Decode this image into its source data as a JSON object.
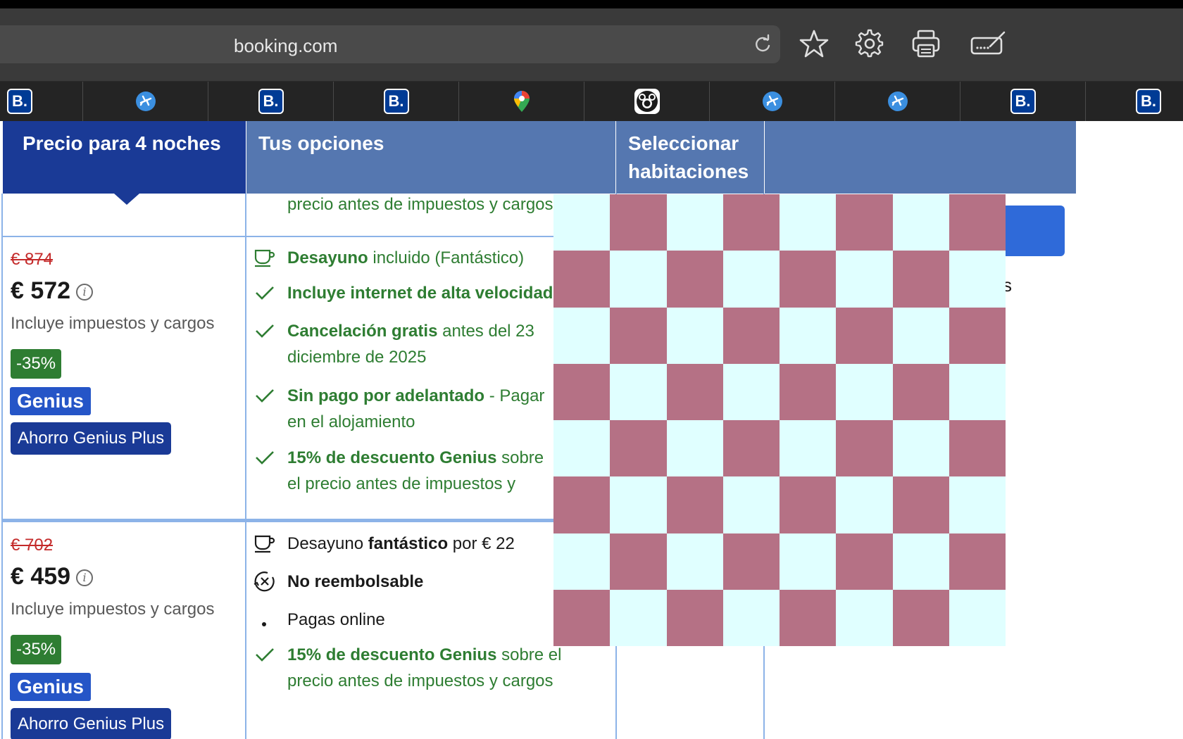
{
  "browser": {
    "url": "booking.com",
    "toolbar_icons": [
      "reload-icon",
      "star-icon",
      "gear-icon",
      "printer-icon",
      "signature-icon"
    ],
    "tabs": [
      {
        "icon": "booking-icon",
        "label": "B."
      },
      {
        "icon": "plane-icon"
      },
      {
        "icon": "booking-icon",
        "label": "B."
      },
      {
        "icon": "booking-icon",
        "label": "B."
      },
      {
        "icon": "maps-pin-icon"
      },
      {
        "icon": "mickey-icon"
      },
      {
        "icon": "plane-icon"
      },
      {
        "icon": "plane-icon"
      },
      {
        "icon": "booking-icon",
        "label": "B."
      },
      {
        "icon": "booking-icon",
        "label": "B."
      }
    ]
  },
  "table": {
    "headers": {
      "price": "Precio para 4 noches",
      "options": "Tus opciones",
      "select": "Seleccionar habitaciones"
    },
    "top_partial": "precio antes de impuestos y cargos",
    "rows": [
      {
        "old_price": "€ 874",
        "price": "€ 572",
        "includes": "Incluye impuestos y cargos",
        "discount": "-35%",
        "genius": "Genius",
        "genius_plus": "Ahorro Genius Plus",
        "options": [
          {
            "bold": "Desayuno",
            "text": " incluido (Fantástico)"
          },
          {
            "bold": "Incluye internet de alta velocidad",
            "text": ""
          },
          {
            "bold": "Cancelación gratis",
            "text": " antes del 23 diciembre de 2025"
          },
          {
            "bold": "Sin pago por adelantado",
            "text": " - Pagar en el alojamiento"
          },
          {
            "bold": "15% de descuento Genius",
            "text": " sobre el precio antes de impuestos y cargos"
          }
        ]
      },
      {
        "old_price": "€ 702",
        "price": "€ 459",
        "includes": "Incluye impuestos y cargos",
        "discount": "-35%",
        "genius": "Genius",
        "genius_plus": "Ahorro Genius Plus",
        "options": [
          {
            "pre": "Desayuno ",
            "bold": "fantástico",
            "text": " por € 22"
          },
          {
            "bold": "No reembolsable",
            "text": ""
          },
          {
            "bold": "",
            "text": "Pagas online"
          },
          {
            "bold": "15% de descuento Genius",
            "text": " sobre el precio antes de impuestos y cargos"
          }
        ]
      }
    ],
    "partial_right_text": "s"
  },
  "colors": {
    "header_dark": "#1a3a96",
    "header_light": "#5577b0",
    "green": "#2e7d32",
    "red_strike": "#c42a2a",
    "checker_a": "#b57185",
    "checker_b": "#e0ffff"
  }
}
